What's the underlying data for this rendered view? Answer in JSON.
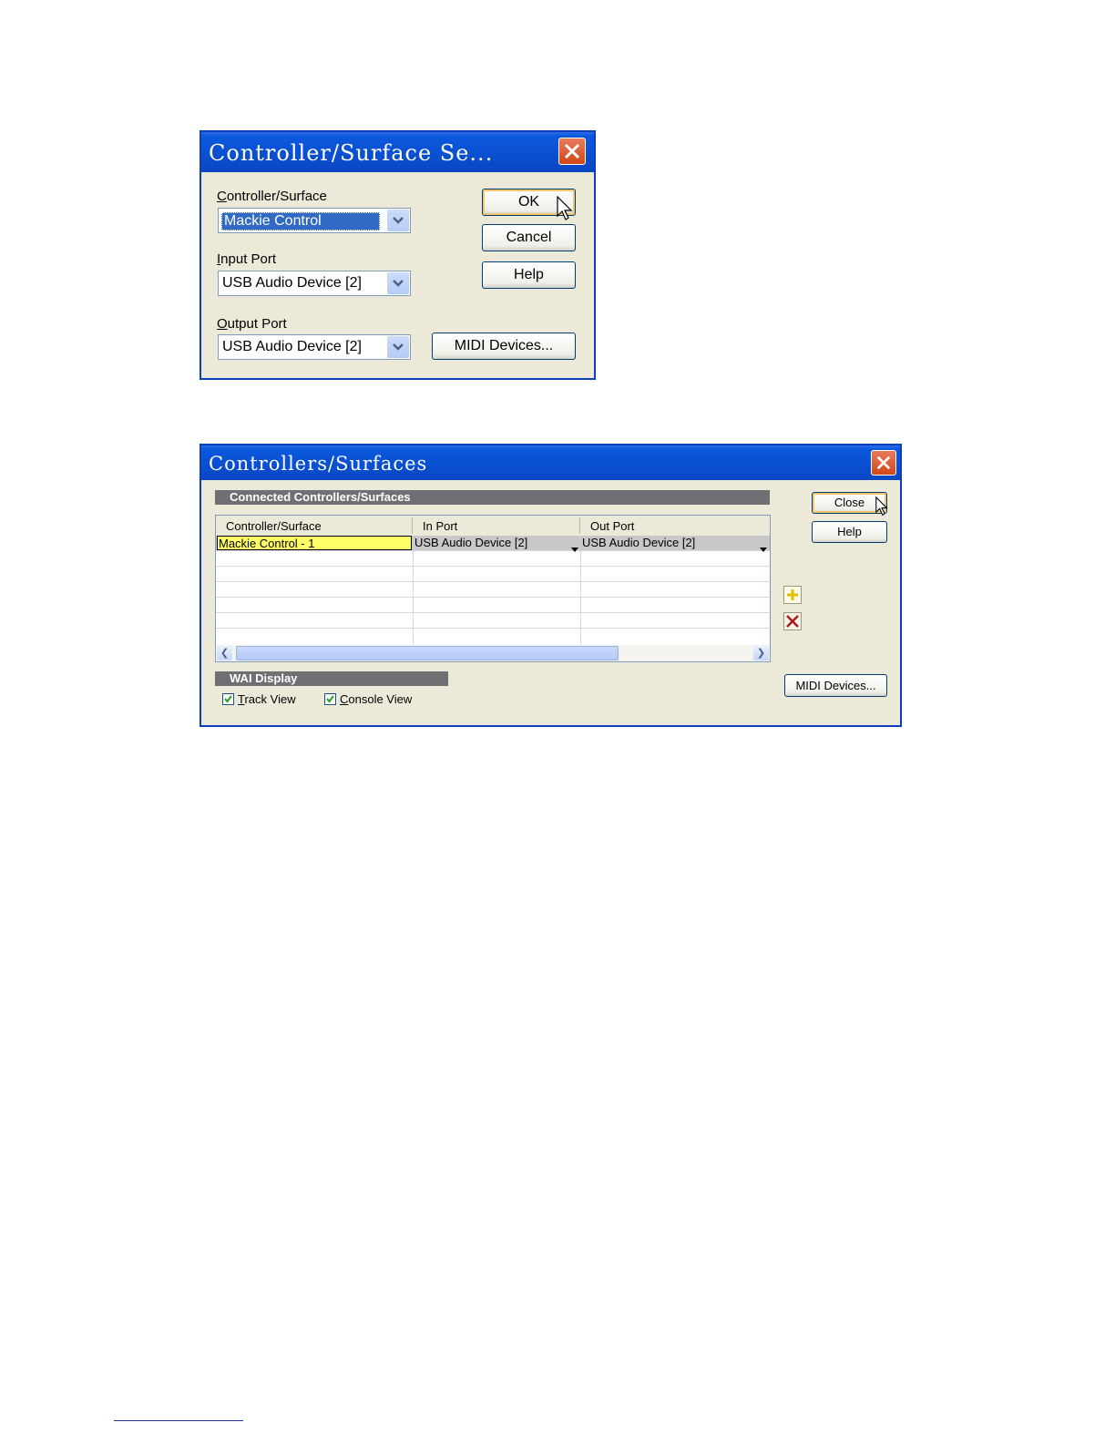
{
  "dialog1": {
    "title": "Controller/Surface Se...",
    "controller_label_u": "C",
    "controller_label_rest": "ontroller/Surface",
    "controller_value": "Mackie Control",
    "input_label_u": "I",
    "input_label_rest": "nput Port",
    "input_value": "USB Audio Device [2]",
    "output_label_u": "O",
    "output_label_rest": "utput Port",
    "output_value": "USB Audio Device [2]",
    "ok_label": "OK",
    "cancel_label": "Cancel",
    "help_label": "Help",
    "midi_label": "MIDI Devices..."
  },
  "dialog2": {
    "title": "Controllers/Surfaces",
    "connected_header": "Connected Controllers/Surfaces",
    "columns": [
      "Controller/Surface",
      "In Port",
      "Out Port"
    ],
    "rows": [
      {
        "controller": "Mackie Control - 1",
        "in_port": "USB Audio Device [2]",
        "out_port": "USB Audio Device [2]"
      }
    ],
    "close_label": "Close",
    "help_label": "Help",
    "midi_label": "MIDI Devices...",
    "wai_header": "WAI Display",
    "track_view_u": "T",
    "track_view_rest": "rack View",
    "track_view_checked": true,
    "console_view_u": "C",
    "console_view_rest": "onsole View",
    "console_view_checked": true
  },
  "icons": {
    "close": "close-icon",
    "dropdown": "chevron-down-icon",
    "cursor": "mouse-cursor-icon",
    "add": "add-icon",
    "delete": "delete-icon",
    "check": "checkmark-icon"
  }
}
